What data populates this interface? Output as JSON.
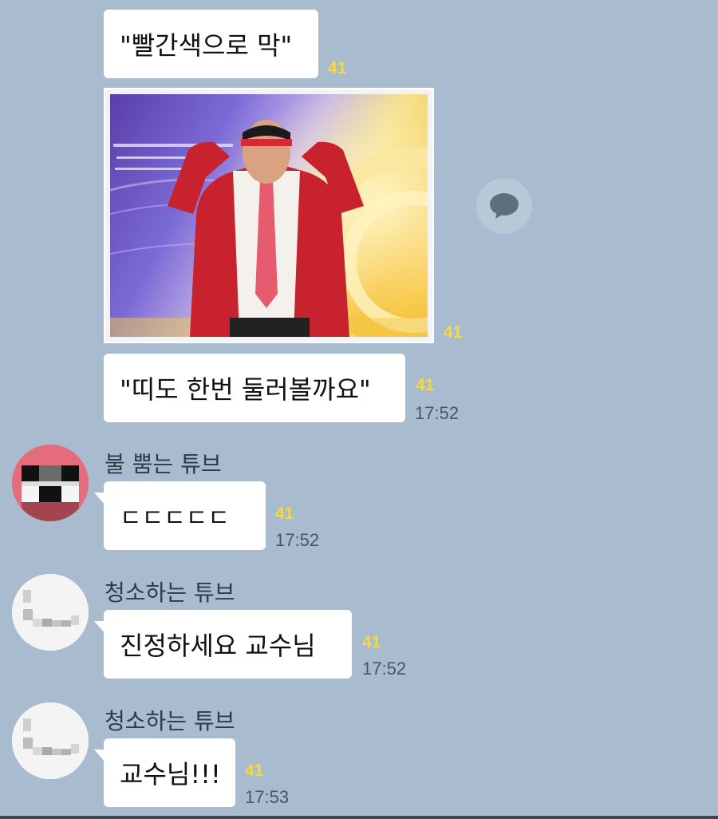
{
  "messages": {
    "m1": {
      "text": "\"빨간색으로 막\"",
      "unread": "41"
    },
    "m2": {
      "unread": "41"
    },
    "m3": {
      "text": "\"띠도 한번 둘러볼까요\"",
      "unread": "41",
      "time": "17:52"
    },
    "m4": {
      "sender": "불 뿜는 튜브",
      "text": "ㄷㄷㄷㄷㄷ",
      "unread": "41",
      "time": "17:52"
    },
    "m5": {
      "sender": "청소하는 튜브",
      "text": "진정하세요 교수님",
      "unread": "41",
      "time": "17:52"
    },
    "m6": {
      "sender": "청소하는 튜브",
      "text": "교수님!!!",
      "unread": "41",
      "time": "17:53"
    }
  },
  "icons": {
    "share": "speech-bubble-icon"
  },
  "colors": {
    "background": "#a9bccf",
    "bubble": "#ffffff",
    "unread": "#f7d93a"
  }
}
